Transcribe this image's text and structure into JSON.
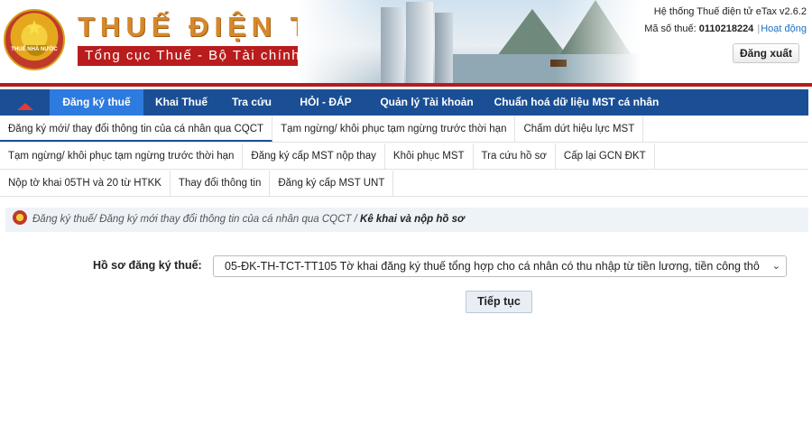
{
  "header": {
    "emblem_text": "THUẾ NHÀ NƯỚC",
    "title": "THUẾ ĐIỆN TỬ",
    "subtitle": "Tổng cục Thuế - Bộ Tài chính",
    "system_info": "Hệ thống Thuế điện tử eTax v2.6.2",
    "tax_code_label": "Mã số thuế:",
    "tax_code": "0110218224",
    "status": "Hoạt động",
    "logout_label": "Đăng xuất"
  },
  "main_nav": {
    "items": [
      {
        "label": "Đăng ký thuế",
        "active": true
      },
      {
        "label": "Khai Thuế"
      },
      {
        "label": "Tra cứu"
      },
      {
        "label": "HỎI - ĐÁP"
      },
      {
        "label": "Quản lý Tài khoản"
      },
      {
        "label": "Chuẩn hoá dữ liệu MST cá nhân"
      }
    ]
  },
  "sub_nav": {
    "row1": [
      "Đăng ký mới/ thay đổi thông tin của cá nhân qua CQCT",
      "Tạm ngừng/ khôi phục tạm ngừng trước thời hạn",
      "Chấm dứt hiệu lực MST"
    ],
    "row2": [
      "Tạm ngừng/ khôi phục tạm ngừng trước thời hạn",
      "Đăng ký cấp MST nộp thay",
      "Khôi phục MST",
      "Tra cứu hồ sơ",
      "Cấp lại GCN ĐKT"
    ],
    "row3": [
      "Nộp tờ khai 05TH và 20 từ HTKK",
      "Thay đổi thông tin",
      "Đăng ký cấp MST UNT"
    ]
  },
  "breadcrumb": {
    "path": "Đăng ký thuế/ Đăng ký mới thay đổi thông tin của cá nhân qua CQCT / ",
    "current": "Kê khai và nộp hồ sơ"
  },
  "form": {
    "label": "Hồ sơ đăng ký thuế:",
    "selected": "05-ĐK-TH-TCT-TT105 Tờ khai đăng ký thuế tổng hợp cho cá nhân có thu nhập từ tiền lương, tiền công thô",
    "continue_label": "Tiếp tục"
  },
  "colors": {
    "nav_bg": "#1a4f96",
    "nav_active": "#2e7be0",
    "brand_red": "#b71c1c",
    "title_orange": "#d6892a"
  }
}
